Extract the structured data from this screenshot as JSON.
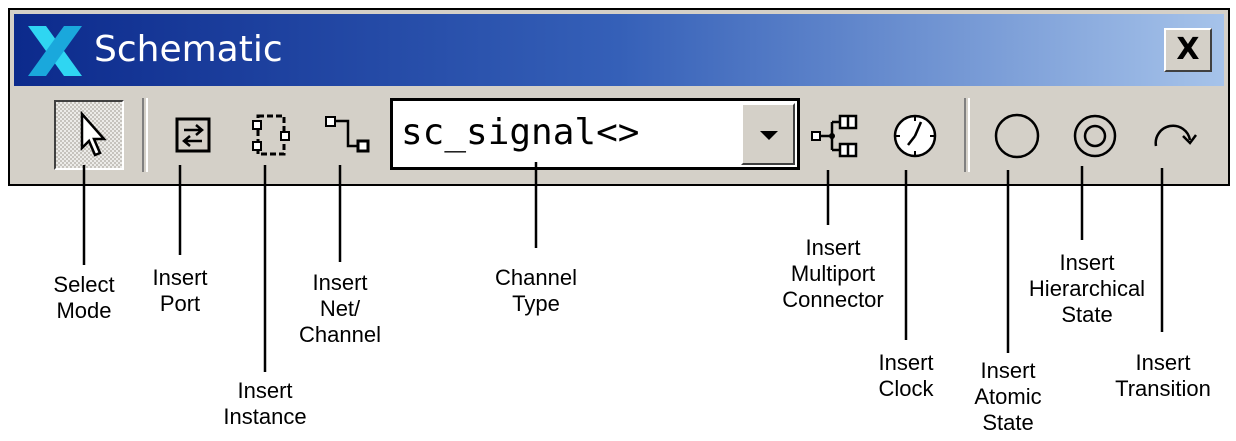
{
  "window": {
    "title": "Schematic",
    "close_label": "X"
  },
  "toolbar": {
    "channel_type_value": "sc_signal<>"
  },
  "callouts": {
    "select_mode": "Select\nMode",
    "insert_port": "Insert\nPort",
    "insert_instance": "Insert\nInstance",
    "insert_net_channel": "Insert\nNet/\nChannel",
    "channel_type": "Channel\nType",
    "insert_multiport_connector": "Insert\nMultiport\nConnector",
    "insert_clock": "Insert\nClock",
    "insert_atomic_state": "Insert\nAtomic\nState",
    "insert_hierarchical_state": "Insert\nHierarchical\nState",
    "insert_transition": "Insert\nTransition"
  },
  "icons": {
    "app": "x-logo-icon",
    "select": "cursor-arrow-icon",
    "port": "port-swap-icon",
    "instance": "instance-block-icon",
    "net": "net-channel-icon",
    "multiport": "multiport-connector-icon",
    "clock": "clock-icon",
    "atomic_state": "circle-icon",
    "hierarchical_state": "double-circle-icon",
    "transition": "curved-arrow-icon"
  },
  "colors": {
    "titlebar_start": "#0c2a8c",
    "titlebar_end": "#a6c3ea",
    "window_face": "#d4d0c8"
  }
}
